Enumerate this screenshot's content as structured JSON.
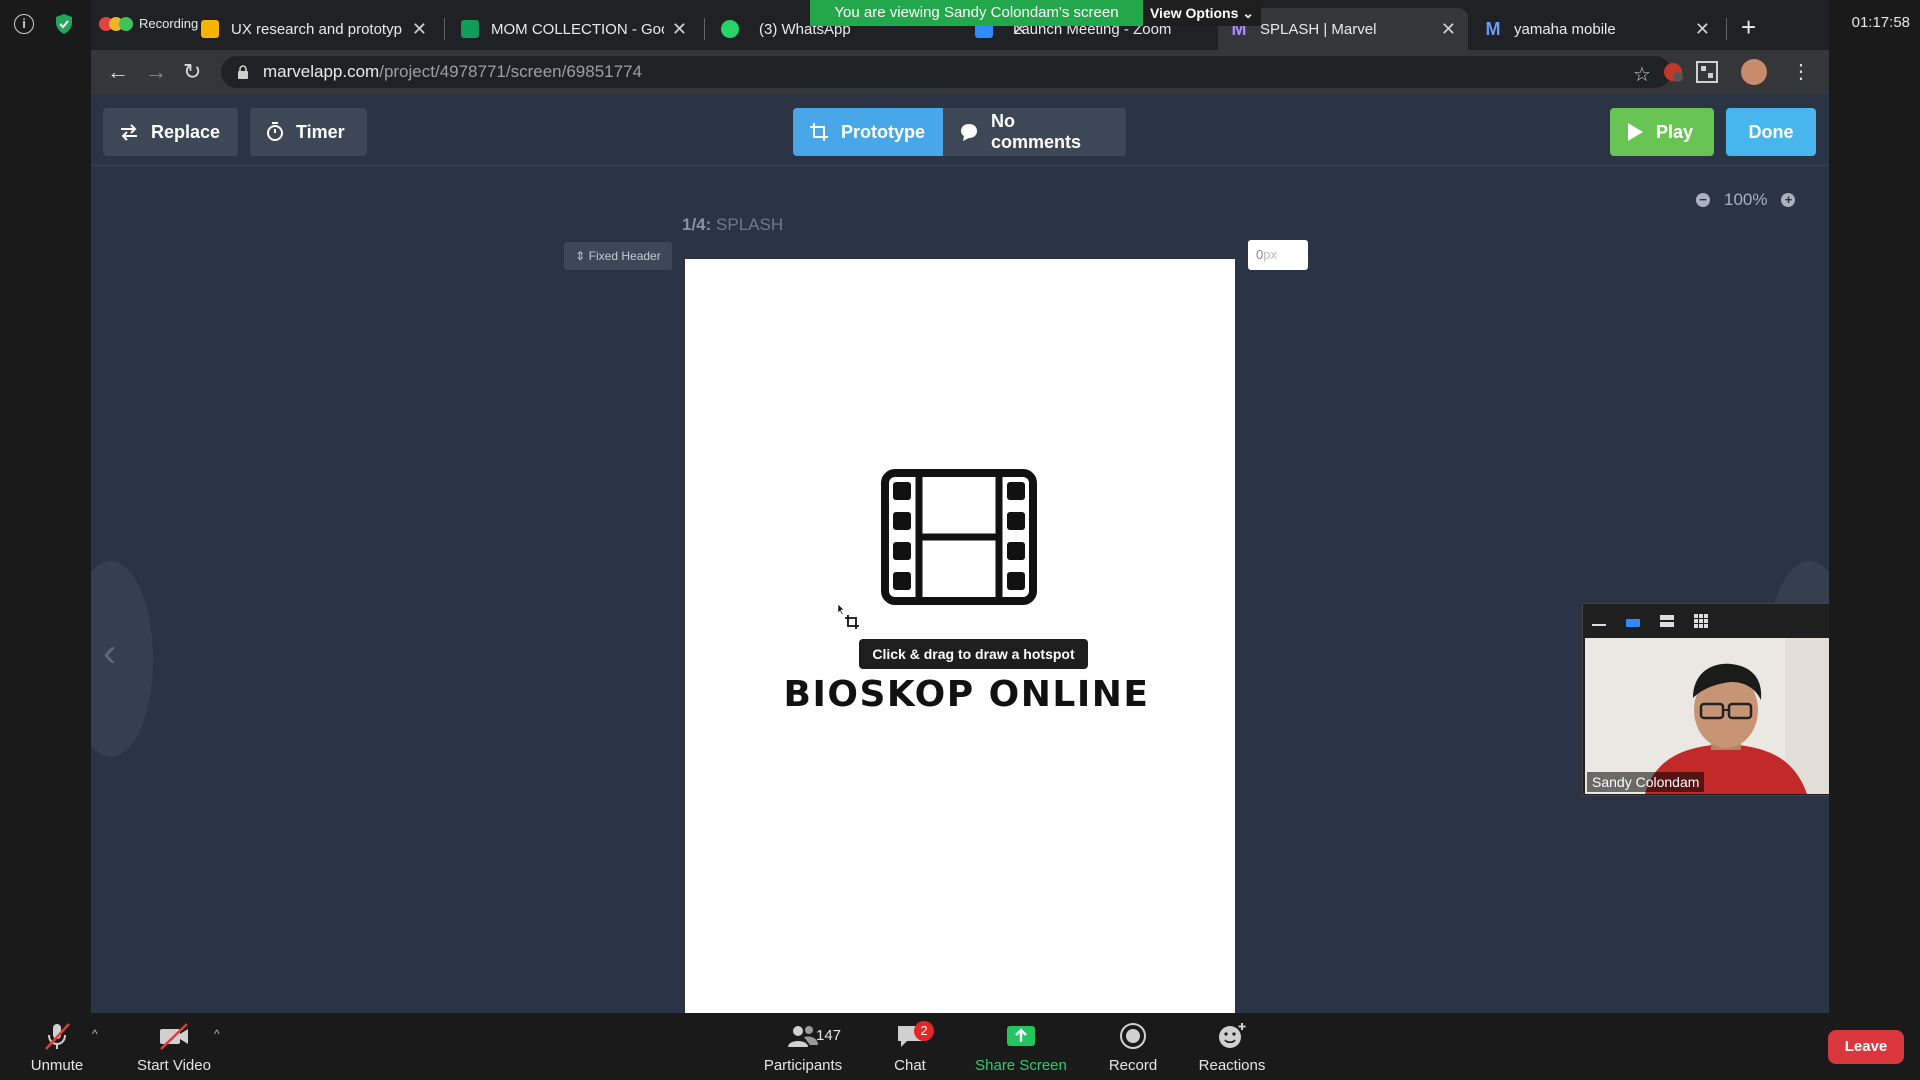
{
  "zoom": {
    "clock": "01:17:58",
    "share_banner": "You are viewing Sandy Colondam's screen",
    "view_options": "View Options",
    "recording_label": "Recording",
    "toolbar": {
      "unmute": "Unmute",
      "start_video": "Start Video",
      "participants": "Participants",
      "participants_count": "147",
      "chat": "Chat",
      "chat_badge": "2",
      "share_screen": "Share Screen",
      "record": "Record",
      "reactions": "Reactions",
      "leave": "Leave"
    },
    "video_tile": {
      "name": "Sandy Colondam"
    }
  },
  "browser": {
    "tabs": [
      {
        "title": "UX research and prototyp",
        "favicon_color": "#f4b400"
      },
      {
        "title": "MOM COLLECTION - Goo",
        "favicon_color": "#0f9d58"
      },
      {
        "title": "(3) WhatsApp",
        "favicon_color": "#25d366"
      },
      {
        "title": "Launch Meeting - Zoom",
        "favicon_color": "#2d8cff"
      },
      {
        "title": "SPLASH | Marvel",
        "favicon_color": "#8a6cf0"
      },
      {
        "title": "yamaha mobile",
        "favicon_color": "#4b7bec"
      }
    ],
    "url_host": "marvelapp.com",
    "url_path": "/project/4978771/screen/69851774"
  },
  "marvel": {
    "replace": "Replace",
    "timer": "Timer",
    "prototype": "Prototype",
    "comments": "No comments",
    "play": "Play",
    "done": "Done",
    "screen_index": "1/4:",
    "screen_name": "SPLASH",
    "fixed_header": "Fixed Header",
    "px_value": "0",
    "px_unit": "px",
    "zoom": "100%",
    "tooltip": "Click & drag to draw a hotspot",
    "app_name": "BIOSKOP ONLINE"
  },
  "colors": {
    "accent_blue": "#47a7e8",
    "play_green": "#69c553",
    "leave_red": "#d9363e",
    "share_green": "#22a84a"
  }
}
